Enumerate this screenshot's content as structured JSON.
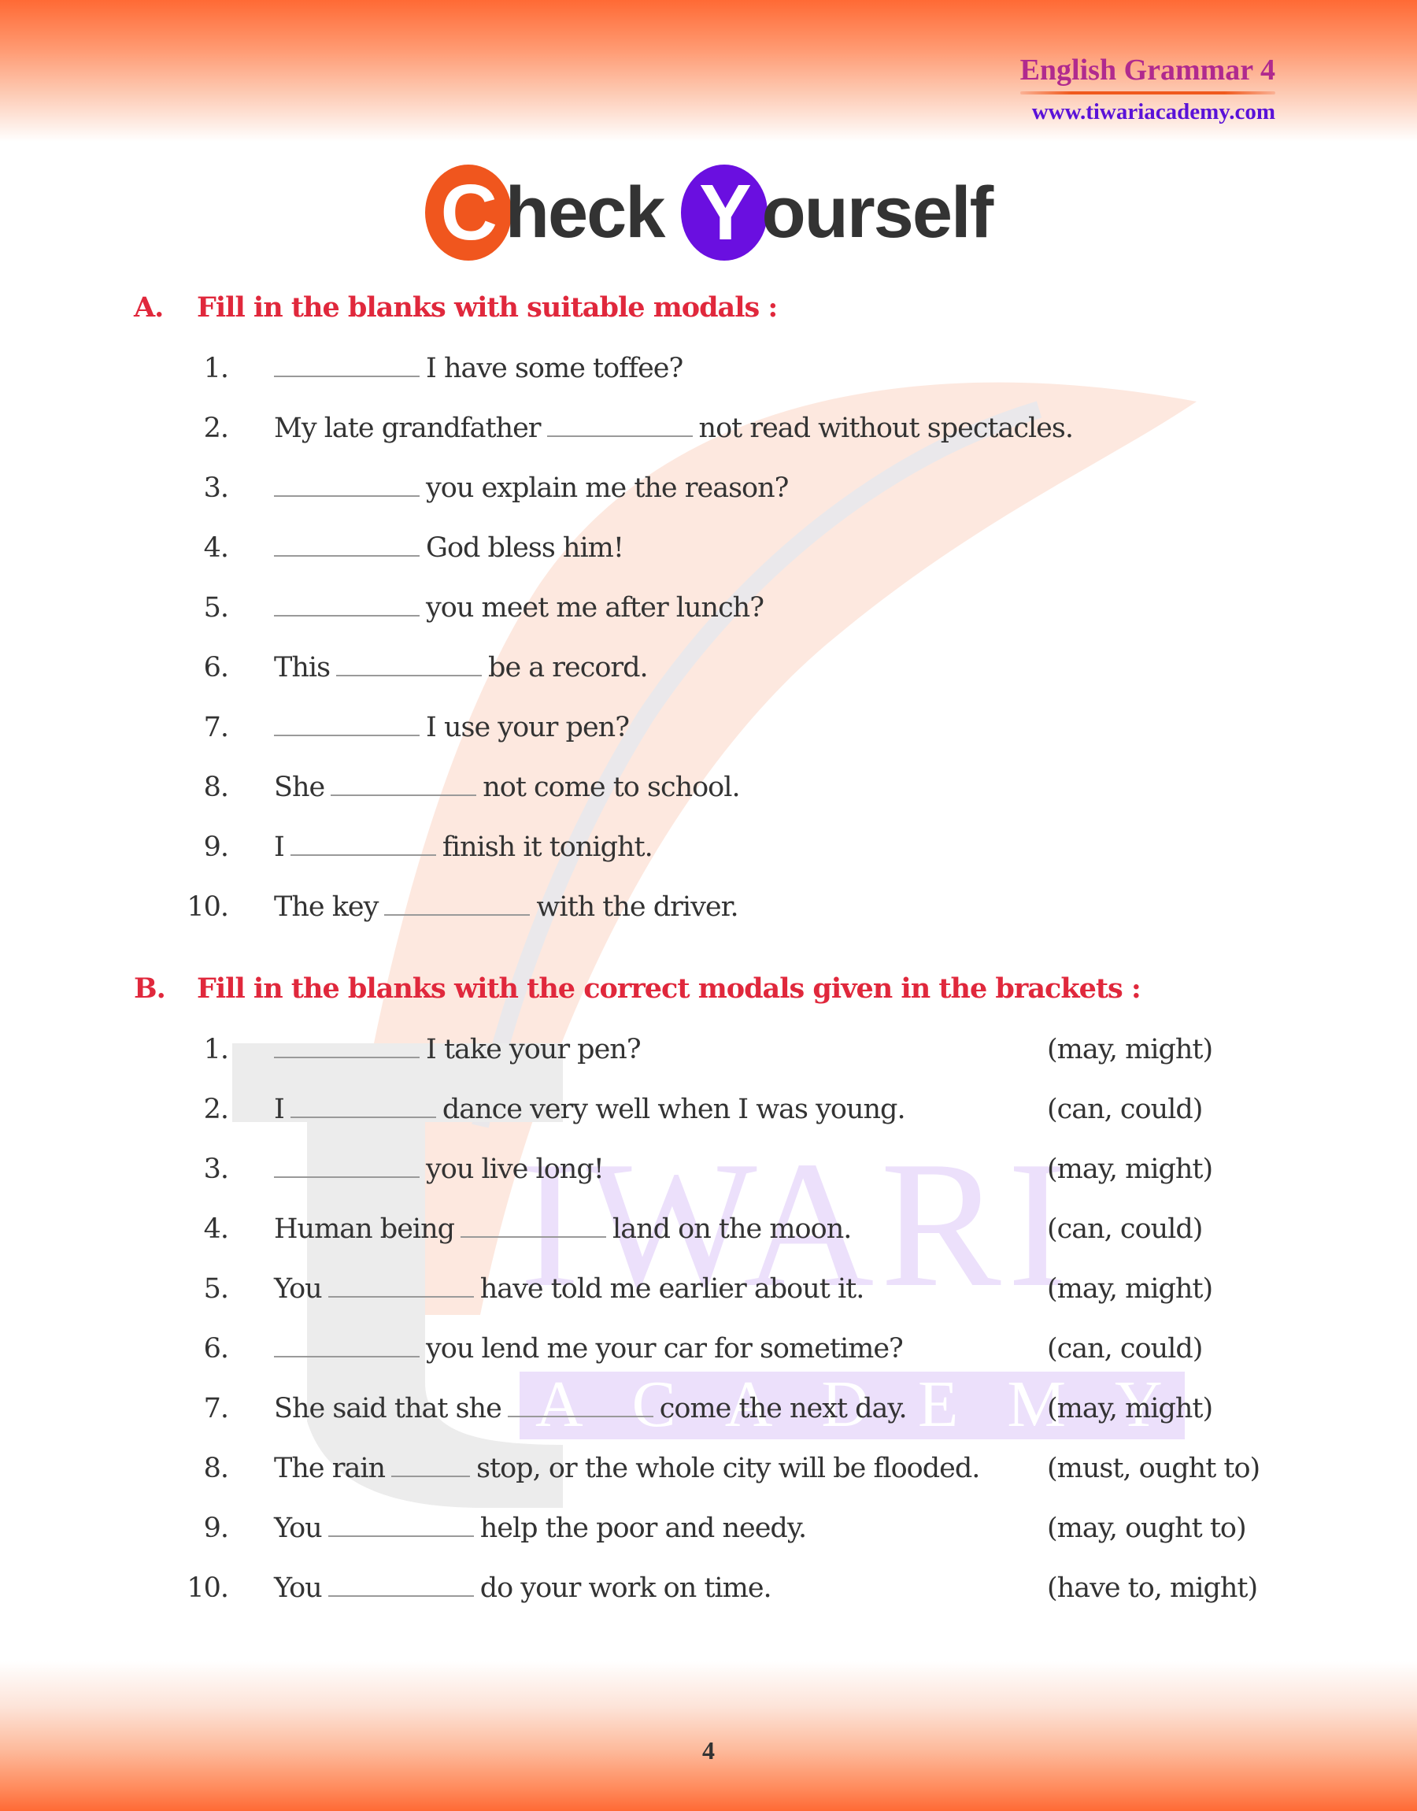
{
  "header": {
    "book_title": "English Grammar 4",
    "website": "www.tiwariacademy.com"
  },
  "title": {
    "initial_1": "C",
    "rest_1": "heck",
    "initial_2": "Y",
    "rest_2": "ourself",
    "colors": {
      "c_circle": "#f0561e",
      "y_circle": "#6a0fe0",
      "text": "#333333"
    }
  },
  "watermark": {
    "word_1": "IWARI",
    "word_2": "ACADEMY"
  },
  "section_a": {
    "letter": "A.",
    "heading": "Fill in the blanks with suitable modals :",
    "items": [
      {
        "num": "1.",
        "before": "",
        "after": "I have some toffee?"
      },
      {
        "num": "2.",
        "before": "My late grandfather",
        "after": "not read without spectacles."
      },
      {
        "num": "3.",
        "before": "",
        "after": "you explain me the reason?"
      },
      {
        "num": "4.",
        "before": "",
        "after": "God bless him!"
      },
      {
        "num": "5.",
        "before": "",
        "after": "you meet me after lunch?"
      },
      {
        "num": "6.",
        "before": "This",
        "after": "be a record."
      },
      {
        "num": "7.",
        "before": "",
        "after": "I use your pen?"
      },
      {
        "num": "8.",
        "before": "She",
        "after": "not come to school."
      },
      {
        "num": "9.",
        "before": "I",
        "after": "finish it tonight."
      },
      {
        "num": "10.",
        "before": "The key",
        "after": "with the driver."
      }
    ]
  },
  "section_b": {
    "letter": "B.",
    "heading": "Fill in the blanks with the correct modals given in the brackets :",
    "items": [
      {
        "num": "1.",
        "before": "",
        "after": "I take your pen?",
        "options": "(may, might)"
      },
      {
        "num": "2.",
        "before": "I",
        "after": "dance very well when I was young.",
        "options": "(can, could)"
      },
      {
        "num": "3.",
        "before": "",
        "after": "you live long!",
        "options": "(may, might)"
      },
      {
        "num": "4.",
        "before": "Human being",
        "after": "land on the moon.",
        "options": "(can, could)"
      },
      {
        "num": "5.",
        "before": "You",
        "after": "have told me earlier about it.",
        "options": "(may, might)"
      },
      {
        "num": "6.",
        "before": "",
        "after": "you lend me your car for sometime?",
        "options": "(can, could)"
      },
      {
        "num": "7.",
        "before": "She said that she",
        "after": "come the next day.",
        "options": "(may, might)"
      },
      {
        "num": "8.",
        "before": "The rain",
        "after": "stop, or the whole city will be flooded.",
        "options": "(must, ought to)"
      },
      {
        "num": "9.",
        "before": "You",
        "after": "help the poor and needy.",
        "options": "(may, ought to)"
      },
      {
        "num": "10.",
        "before": "You",
        "after": "do your work on time.",
        "options": "(have to, might)"
      }
    ]
  },
  "footer": {
    "page_number": "4"
  },
  "colors": {
    "band": "#ff6a35",
    "heading_red": "#e0283c",
    "brand_magenta": "#b02a8e",
    "brand_purple": "#5a12d8"
  }
}
